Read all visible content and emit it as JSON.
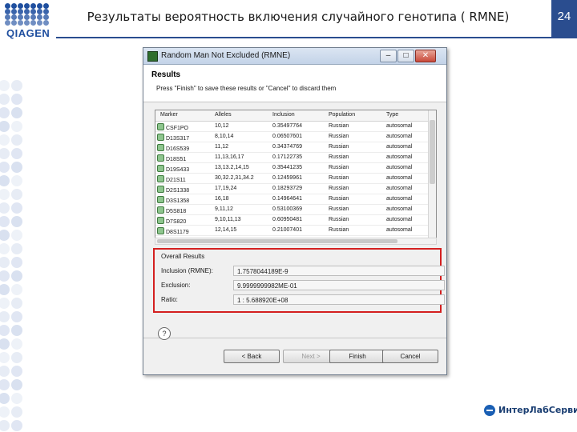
{
  "logo": {
    "text": "QIAGEN"
  },
  "slide": {
    "title": "Результаты вероятность включения случайного генотипа ( RMNE)",
    "page_number": "24"
  },
  "dialog": {
    "window_title": "Random Man Not Excluded (RMNE)",
    "banner_title": "Results",
    "banner_message": "Press \"Finish\" to save these results or \"Cancel\" to discard them",
    "title_buttons": {
      "minimize": "–",
      "maximize": "□",
      "close": "✕"
    },
    "table": {
      "columns": [
        "Marker",
        "Alleles",
        "Inclusion",
        "Population",
        "Type"
      ],
      "rows": [
        {
          "marker": "CSF1PO",
          "alleles": "10,12",
          "inclusion": "0.35497764",
          "population": "Russian",
          "type": "autosomal"
        },
        {
          "marker": "D13S317",
          "alleles": "8,10,14",
          "inclusion": "0.06507601",
          "population": "Russian",
          "type": "autosomal"
        },
        {
          "marker": "D16S539",
          "alleles": "11,12",
          "inclusion": "0.34374769",
          "population": "Russian",
          "type": "autosomal"
        },
        {
          "marker": "D18S51",
          "alleles": "11,13,16,17",
          "inclusion": "0.17122735",
          "population": "Russian",
          "type": "autosomal"
        },
        {
          "marker": "D19S433",
          "alleles": "13,13.2,14,15",
          "inclusion": "0.35441235",
          "population": "Russian",
          "type": "autosomal"
        },
        {
          "marker": "D21S11",
          "alleles": "30,32.2,31,34.2",
          "inclusion": "0.12459961",
          "population": "Russian",
          "type": "autosomal"
        },
        {
          "marker": "D2S1338",
          "alleles": "17,19,24",
          "inclusion": "0.18293729",
          "population": "Russian",
          "type": "autosomal"
        },
        {
          "marker": "D3S1358",
          "alleles": "16,18",
          "inclusion": "0.14964641",
          "population": "Russian",
          "type": "autosomal"
        },
        {
          "marker": "D5S818",
          "alleles": "9,11,12",
          "inclusion": "0.53100369",
          "population": "Russian",
          "type": "autosomal"
        },
        {
          "marker": "D7S820",
          "alleles": "9,10,11,13",
          "inclusion": "0.60950481",
          "population": "Russian",
          "type": "autosomal"
        },
        {
          "marker": "D8S1179",
          "alleles": "12,14,15",
          "inclusion": "0.21007401",
          "population": "Russian",
          "type": "autosomal"
        }
      ]
    },
    "overall": {
      "title": "Overall Results",
      "inclusion_label": "Inclusion (RMNE):",
      "inclusion_value": "1.7578044189E-9",
      "exclusion_label": "Exclusion:",
      "exclusion_value": "9.9999999982ME-01",
      "ratio_label": "Ratio:",
      "ratio_value": "1 : 5.688920E+08"
    },
    "help_label": "?",
    "buttons": {
      "back": "< Back",
      "next": "Next >",
      "finish": "Finish",
      "cancel": "Cancel"
    }
  },
  "brand": {
    "text": "ИнтерЛабСервис"
  },
  "colors": {
    "header_blue": "#2a4d8f",
    "highlight_red": "#d42020",
    "logo_blue": "#1f4f9f"
  }
}
